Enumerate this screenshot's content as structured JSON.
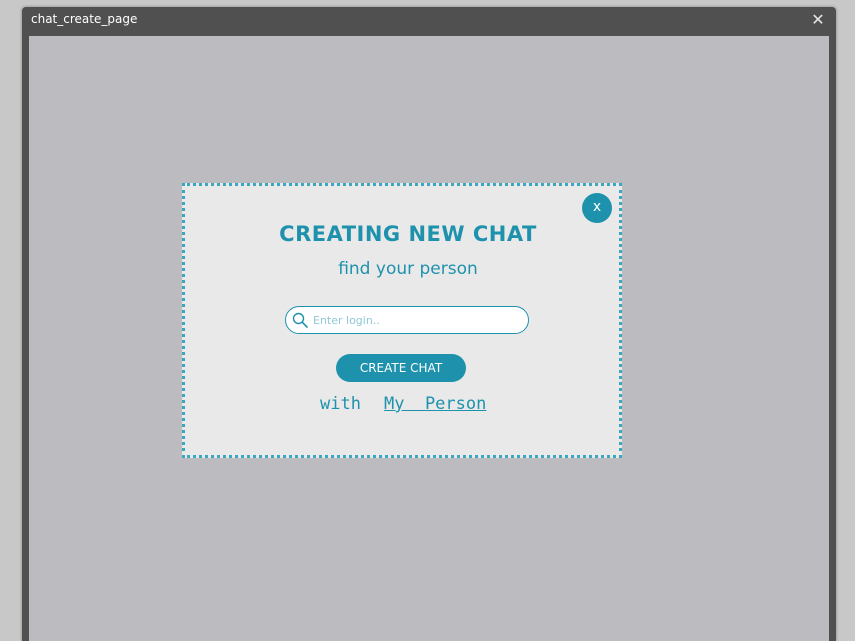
{
  "window": {
    "title": "chat_create_page",
    "close_glyph": "✕"
  },
  "dialog": {
    "close_label": "x",
    "title": "CREATING NEW CHAT",
    "subtitle": "find your person",
    "search": {
      "placeholder": "Enter login..",
      "value": "",
      "icon": "search-icon"
    },
    "create_button_label": "CREATE CHAT",
    "with_label": "with",
    "person_label": "My  Person"
  },
  "colors": {
    "accent": "#1e92ad",
    "dialog_bg": "#e9e9e9",
    "client_bg": "#bcbbbf",
    "window_frame": "#505050"
  }
}
